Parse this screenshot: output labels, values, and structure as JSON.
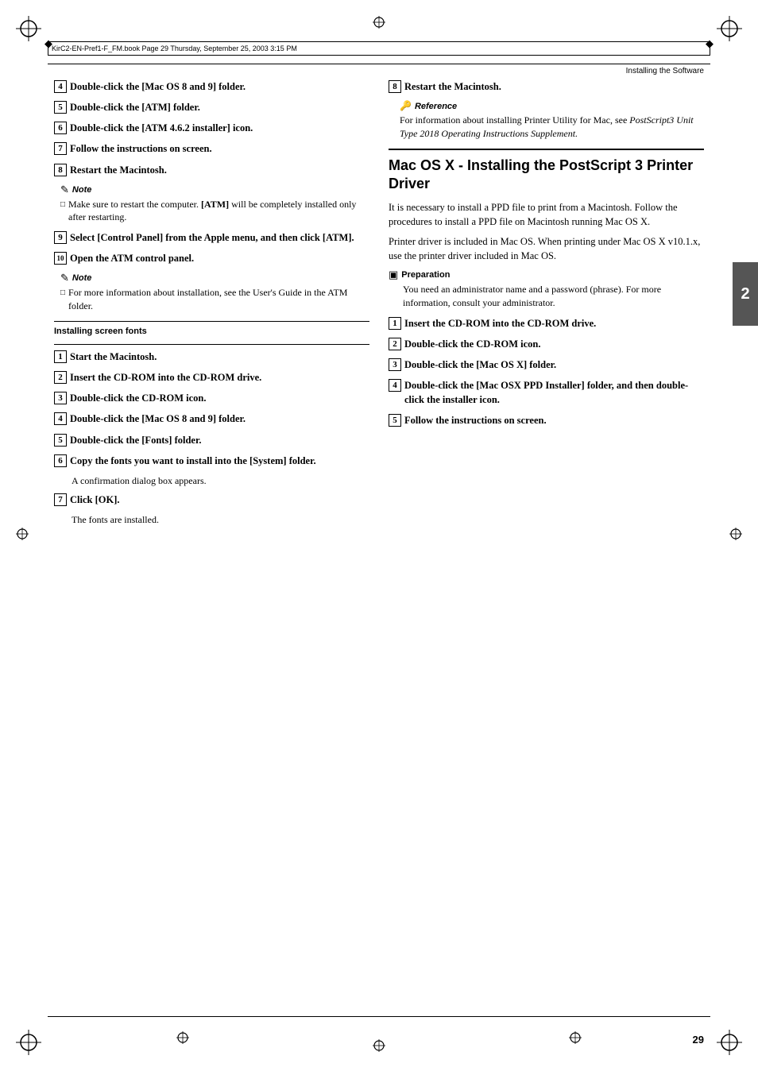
{
  "page": {
    "number": "29",
    "header_text": "Installing the Software",
    "file_info": "KirC2-EN-Pref1-F_FM.book  Page 29  Thursday, September 25, 2003  3:15 PM"
  },
  "left_column": {
    "steps_top": [
      {
        "num": "4",
        "text": "Double-click the [Mac OS 8 and 9] folder."
      },
      {
        "num": "5",
        "text": "Double-click the [ATM] folder."
      },
      {
        "num": "6",
        "text": "Double-click the [ATM 4.6.2 installer] icon."
      },
      {
        "num": "7",
        "text": "Follow the instructions on screen."
      },
      {
        "num": "8",
        "text": "Restart the Macintosh."
      }
    ],
    "note1": {
      "label": "Note",
      "items": [
        "Make sure to restart the computer. [ATM] will be completely installed only after restarting."
      ]
    },
    "steps_mid": [
      {
        "num": "9",
        "text": "Select [Control Panel] from the Apple menu, and then click [ATM]."
      },
      {
        "num": "10",
        "text": "Open the ATM control panel."
      }
    ],
    "note2": {
      "label": "Note",
      "items": [
        "For more information about installation, see the User's Guide in the ATM folder."
      ]
    },
    "divider_label": "Installing screen fonts",
    "steps_fonts": [
      {
        "num": "1",
        "text": "Start the Macintosh."
      },
      {
        "num": "2",
        "text": "Insert the CD-ROM into the CD-ROM drive."
      },
      {
        "num": "3",
        "text": "Double-click the CD-ROM icon."
      },
      {
        "num": "4",
        "text": "Double-click the [Mac OS 8 and 9] folder."
      },
      {
        "num": "5",
        "text": "Double-click the [Fonts] folder."
      },
      {
        "num": "6",
        "text": "Copy the fonts you want to install into the [System] folder.",
        "sub": "A confirmation dialog box appears."
      },
      {
        "num": "7",
        "text": "Click [OK].",
        "sub": "The fonts are installed."
      }
    ]
  },
  "right_column": {
    "step8_right": {
      "num": "8",
      "text": "Restart the Macintosh."
    },
    "reference": {
      "label": "Reference",
      "text": "For information about installing Printer Utility for Mac, see PostScript3 Unit Type 2018 Operating Instructions Supplement.",
      "italic_part": "PostScript3 Unit Type 2018 Operating Instructions Supplement."
    },
    "section_heading": "Mac OS X - Installing the PostScript 3 Printer Driver",
    "body1": "It is necessary to install a PPD file to print from a Macintosh. Follow the procedures to install a PPD file on Macintosh running Mac OS X.",
    "body2": "Printer driver is included in Mac OS. When printing under Mac OS X v10.1.x, use the printer driver included in Mac OS.",
    "preparation": {
      "label": "Preparation",
      "text": "You need an administrator name and a password (phrase). For more information, consult your administrator."
    },
    "steps": [
      {
        "num": "1",
        "text": "Insert the CD-ROM into the CD-ROM drive."
      },
      {
        "num": "2",
        "text": "Double-click the CD-ROM icon."
      },
      {
        "num": "3",
        "text": "Double-click the [Mac OS X] folder."
      },
      {
        "num": "4",
        "text": "Double-click the [Mac OSX PPD Installer] folder, and then double-click the installer icon."
      },
      {
        "num": "5",
        "text": "Follow the instructions on screen."
      }
    ]
  }
}
